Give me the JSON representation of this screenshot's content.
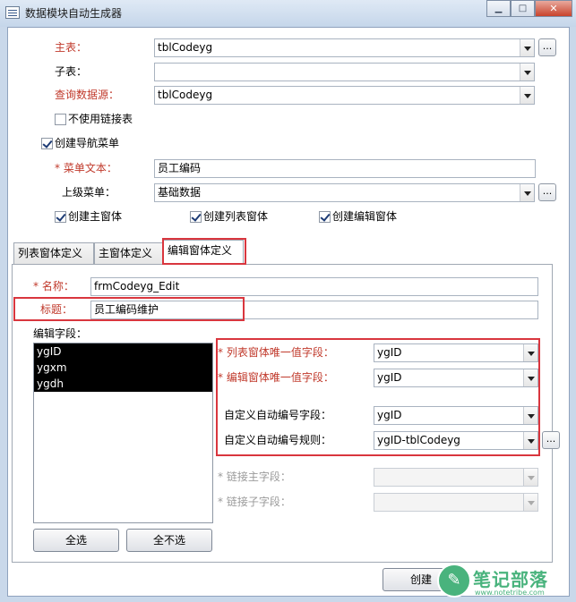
{
  "window": {
    "title": "数据模块自动生成器",
    "min_glyph": "▁",
    "max_glyph": "□",
    "close_glyph": "✕"
  },
  "top": {
    "main_table": {
      "label": "主表：",
      "value": "tblCodeyg"
    },
    "sub_table": {
      "label": "子表：",
      "value": ""
    },
    "query_source": {
      "label": "查询数据源：",
      "value": "tblCodeyg"
    },
    "no_link_table": {
      "label": "不使用链接表",
      "checked": false
    },
    "create_nav_menu": {
      "label": "创建导航菜单",
      "checked": true
    },
    "menu_text": {
      "label": "* 菜单文本：",
      "value": "员工编码"
    },
    "parent_menu": {
      "label": "上级菜单：",
      "value": "基础数据"
    },
    "create_main_form": {
      "label": "创建主窗体",
      "checked": true
    },
    "create_list_form": {
      "label": "创建列表窗体",
      "checked": true
    },
    "create_edit_form": {
      "label": "创建编辑窗体",
      "checked": true
    },
    "ellipsis": "..."
  },
  "tabs": [
    {
      "label": "列表窗体定义",
      "active": false
    },
    {
      "label": "主窗体定义",
      "active": false
    },
    {
      "label": "编辑窗体定义",
      "active": true
    }
  ],
  "edit": {
    "name": {
      "label": "* 名称：",
      "value": "frmCodeyg_Edit"
    },
    "caption": {
      "label": "标题：",
      "value": "员工编码维护"
    },
    "edit_fields_label": "编辑字段：",
    "fields": [
      "ygID",
      "ygxm",
      "ygdh"
    ],
    "list_unique": {
      "label": "* 列表窗体唯一值字段：",
      "value": "ygID"
    },
    "edit_unique": {
      "label": "* 编辑窗体唯一值字段：",
      "value": "ygID"
    },
    "auto_no_field": {
      "label": "自定义自动编号字段：",
      "value": "ygID"
    },
    "auto_no_rule": {
      "label": "自定义自动编号规则：",
      "value": "ygID-tblCodeyg"
    },
    "link_master": {
      "label": "* 链接主字段：",
      "value": ""
    },
    "link_child": {
      "label": "* 链接子字段：",
      "value": ""
    },
    "select_all": "全选",
    "select_none": "全不选"
  },
  "footer": {
    "create_button": "创建"
  },
  "watermark": {
    "glyph": "✎",
    "text": "笔记部落",
    "url": "www.notetribe.com"
  }
}
